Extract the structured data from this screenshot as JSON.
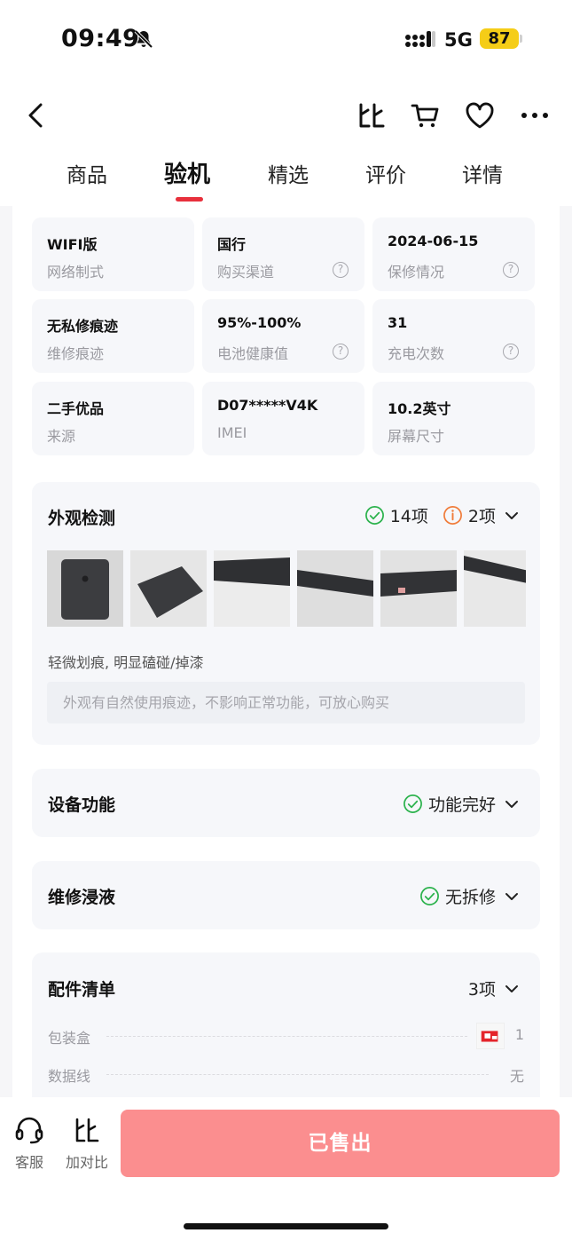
{
  "status": {
    "time": "09:49",
    "network": "5G",
    "battery": "87"
  },
  "tabs": [
    "商品",
    "验机",
    "精选",
    "评价",
    "详情"
  ],
  "specs": [
    {
      "value": "WIFI版",
      "label": "网络制式",
      "help": false
    },
    {
      "value": "国行",
      "label": "购买渠道",
      "help": true
    },
    {
      "value": "2024-06-15",
      "label": "保修情况",
      "help": true
    },
    {
      "value": "无私修痕迹",
      "label": "维修痕迹",
      "help": false
    },
    {
      "value": "95%-100%",
      "label": "电池健康值",
      "help": true
    },
    {
      "value": "31",
      "label": "充电次数",
      "help": true
    },
    {
      "value": "二手优品",
      "label": "来源",
      "help": false
    },
    {
      "value": "D07*****V4K",
      "label": "IMEI",
      "help": false
    },
    {
      "value": "10.2英寸",
      "label": "屏幕尺寸",
      "help": false
    }
  ],
  "appearance": {
    "title": "外观检测",
    "pass_count": "14项",
    "warn_count": "2项",
    "desc": "轻微划痕, 明显磕碰/掉漆",
    "note": "外观有自然使用痕迹，不影响正常功能，可放心购买"
  },
  "function": {
    "title": "设备功能",
    "status": "功能完好"
  },
  "repair": {
    "title": "维修浸液",
    "status": "无拆修"
  },
  "accessories": {
    "title": "配件清单",
    "count": "3项",
    "items": [
      {
        "name": "包装盒",
        "value": "1"
      },
      {
        "name": "数据线",
        "value": "无"
      }
    ]
  },
  "bottom": {
    "service_label": "客服",
    "compare_label": "加对比",
    "sold_label": "已售出"
  },
  "colors": {
    "accent": "#e8303c",
    "sold_button": "#fb8e8f",
    "check_green": "#2bb24c",
    "warn_orange": "#f07c3a"
  }
}
